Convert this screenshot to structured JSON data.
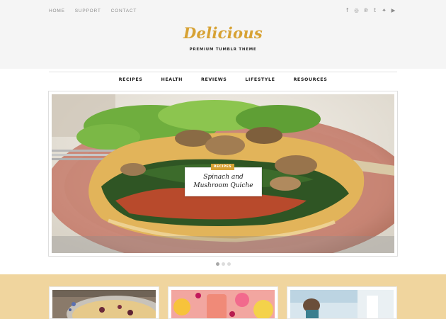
{
  "header": {
    "top_links": [
      "HOME",
      "SUPPORT",
      "CONTACT"
    ],
    "socials": [
      {
        "icon": "facebook-icon",
        "glyph": "f"
      },
      {
        "icon": "instagram-icon",
        "glyph": "◎"
      },
      {
        "icon": "pinterest-icon",
        "glyph": "℗"
      },
      {
        "icon": "tumblr-icon",
        "glyph": "t"
      },
      {
        "icon": "twitter-icon",
        "glyph": "✦"
      },
      {
        "icon": "youtube-icon",
        "glyph": "▶"
      }
    ],
    "logo": "Delicious",
    "tagline": "PREMIUM TUMBLR THEME"
  },
  "nav": {
    "items": [
      "RECIPES",
      "HEALTH",
      "REVIEWS",
      "LIFESTYLE",
      "RESOURCES"
    ]
  },
  "featured": {
    "category": "RECIPES",
    "title_line1": "Spinach and",
    "title_line2": "Mushroom Quiche",
    "slides_total": 3,
    "active_slide": 1
  },
  "colors": {
    "accent": "#d7a234",
    "band": "#f0d59e",
    "header_bg": "#f5f5f5"
  }
}
